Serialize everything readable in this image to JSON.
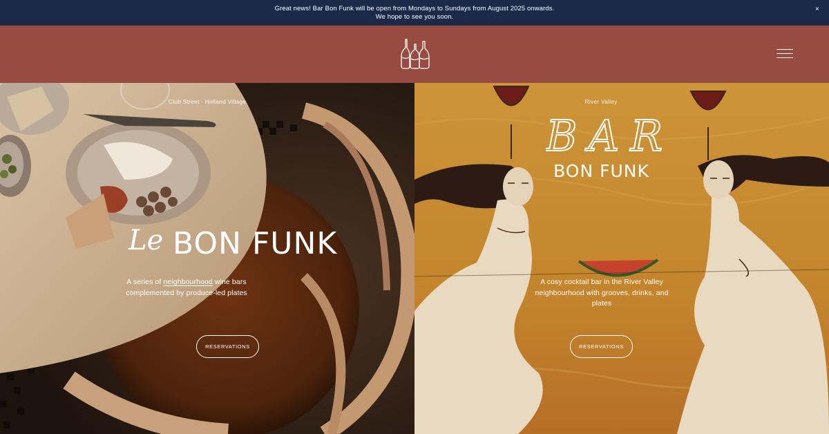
{
  "announcement": {
    "line1": "Great news! Bar Bon Funk will be open from Mondays to Sundays from August 2025 onwards.",
    "line2": "We hope to see you soon.",
    "close_label": "×"
  },
  "header": {
    "logo_icon": "three-bottles-logo",
    "menu_icon": "hamburger-menu-icon"
  },
  "left": {
    "location": "Club Street · Holland Village",
    "title_prefix": "Le",
    "title_main": "BON FUNK",
    "desc_before": "A series of ",
    "desc_link": "neighbourhood",
    "desc_after": " wine bars",
    "desc_line2": "complemented by produce-led plates",
    "button": "RESERVATIONS"
  },
  "right": {
    "location": "River Valley",
    "title_prefix": "BAR",
    "title_main": "BON FUNK",
    "desc_line1": "A cosy cocktail bar in the River Valley",
    "desc_line2": "neighbourhood with grooves, drinks, and",
    "desc_line3": "plates",
    "button": "RESERVATIONS"
  },
  "colors": {
    "announcement_bg": "#1c2a4a",
    "header_bg": "#984b40",
    "text": "#ffffff"
  }
}
